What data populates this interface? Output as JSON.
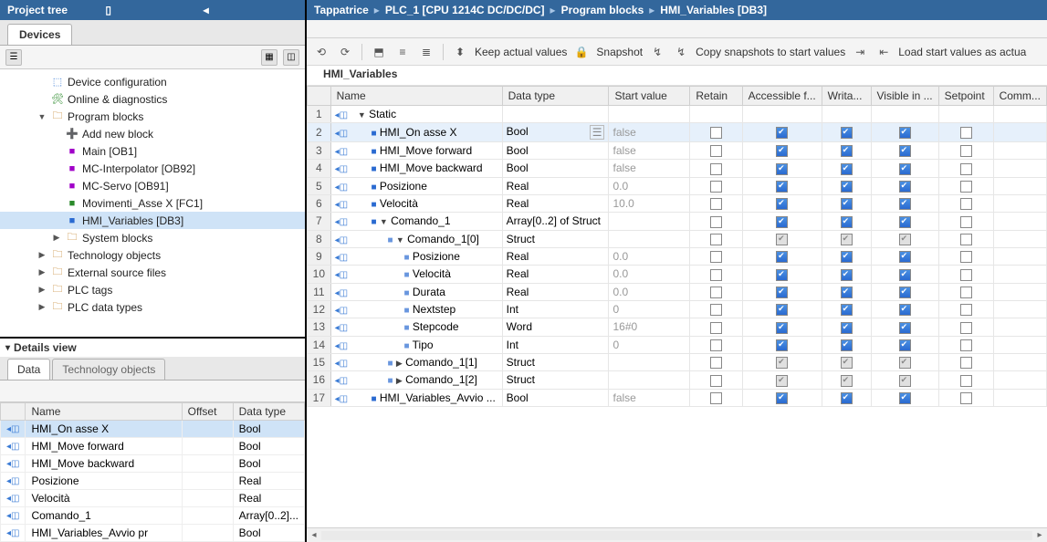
{
  "left": {
    "project_tree_title": "Project tree",
    "devices_tab": "Devices",
    "tree": [
      {
        "indent": 2,
        "icon": "⬚",
        "label": "Device configuration",
        "color": "#3a7bd5"
      },
      {
        "indent": 2,
        "icon": "🛠",
        "label": "Online & diagnostics",
        "color": "#2a8a2a"
      },
      {
        "indent": 2,
        "icon": "🗀",
        "label": "Program blocks",
        "expander": "▼",
        "color": "#b86b00"
      },
      {
        "indent": 3,
        "icon": "➕",
        "label": "Add new block",
        "color": "#a000c8"
      },
      {
        "indent": 3,
        "icon": "■",
        "label": "Main [OB1]",
        "color": "#a000c8"
      },
      {
        "indent": 3,
        "icon": "■",
        "label": "MC-Interpolator [OB92]",
        "color": "#a000c8"
      },
      {
        "indent": 3,
        "icon": "■",
        "label": "MC-Servo [OB91]",
        "color": "#a000c8"
      },
      {
        "indent": 3,
        "icon": "■",
        "label": "Movimenti_Asse X [FC1]",
        "color": "#2a8a2a"
      },
      {
        "indent": 3,
        "icon": "■",
        "label": "HMI_Variables [DB3]",
        "selected": true,
        "color": "#2a6ad1"
      },
      {
        "indent": 3,
        "icon": "🗀",
        "label": "System blocks",
        "expander": "▶",
        "color": "#b86b00"
      },
      {
        "indent": 2,
        "icon": "🗀",
        "label": "Technology objects",
        "expander": "▶",
        "color": "#b86b00"
      },
      {
        "indent": 2,
        "icon": "🗀",
        "label": "External source files",
        "expander": "▶",
        "color": "#b86b00"
      },
      {
        "indent": 2,
        "icon": "🗀",
        "label": "PLC tags",
        "expander": "▶",
        "color": "#b86b00"
      },
      {
        "indent": 2,
        "icon": "🗀",
        "label": "PLC data types",
        "expander": "▶",
        "color": "#b86b00"
      }
    ],
    "details_title": "Details view",
    "details_tabs": {
      "data": "Data",
      "tech": "Technology objects"
    },
    "details_headers": {
      "name": "Name",
      "offset": "Offset",
      "datatype": "Data type"
    },
    "details_rows": [
      {
        "name": "HMI_On asse X",
        "type": "Bool",
        "sel": true
      },
      {
        "name": "HMI_Move forward",
        "type": "Bool"
      },
      {
        "name": "HMI_Move backward",
        "type": "Bool"
      },
      {
        "name": "Posizione",
        "type": "Real"
      },
      {
        "name": "Velocità",
        "type": "Real"
      },
      {
        "name": "Comando_1",
        "type": "Array[0..2]..."
      },
      {
        "name": "HMI_Variables_Avvio pr",
        "type": "Bool",
        "cut": true
      }
    ]
  },
  "right": {
    "crumbs": [
      "Tappatrice",
      "PLC_1 [CPU 1214C DC/DC/DC]",
      "Program blocks",
      "HMI_Variables [DB3]"
    ],
    "toolbar": {
      "keep": "Keep actual values",
      "snapshot": "Snapshot",
      "copy": "Copy snapshots to start values",
      "load": "Load start values as actua"
    },
    "db_title": "HMI_Variables",
    "columns": [
      "",
      "Name",
      "Data type",
      "Start value",
      "Retain",
      "Accessible f...",
      "Writa...",
      "Visible in ...",
      "Setpoint",
      "Comm..."
    ],
    "rows": [
      {
        "n": 1,
        "pin": true,
        "dot": false,
        "exp": "▼",
        "indent": 0,
        "name": "Static",
        "type": "",
        "val": "",
        "checks": [
          "",
          "",
          "",
          "",
          ""
        ]
      },
      {
        "n": 2,
        "pin": true,
        "dot": true,
        "exp": "",
        "indent": 1,
        "name": "HMI_On asse X",
        "type": "Bool",
        "val": "false",
        "sel": true,
        "checks": [
          "off",
          "on",
          "on",
          "on",
          "off"
        ],
        "hasTypeBtn": true
      },
      {
        "n": 3,
        "pin": true,
        "dot": true,
        "exp": "",
        "indent": 1,
        "name": "HMI_Move forward",
        "type": "Bool",
        "val": "false",
        "checks": [
          "off",
          "on",
          "on",
          "on",
          "off"
        ]
      },
      {
        "n": 4,
        "pin": true,
        "dot": true,
        "exp": "",
        "indent": 1,
        "name": "HMI_Move backward",
        "type": "Bool",
        "val": "false",
        "checks": [
          "off",
          "on",
          "on",
          "on",
          "off"
        ]
      },
      {
        "n": 5,
        "pin": true,
        "dot": true,
        "exp": "",
        "indent": 1,
        "name": "Posizione",
        "type": "Real",
        "val": "0.0",
        "checks": [
          "off",
          "on",
          "on",
          "on",
          "off"
        ]
      },
      {
        "n": 6,
        "pin": true,
        "dot": true,
        "exp": "",
        "indent": 1,
        "name": "Velocità",
        "type": "Real",
        "val": "10.0",
        "checks": [
          "off",
          "on",
          "on",
          "on",
          "off"
        ]
      },
      {
        "n": 7,
        "pin": true,
        "dot": true,
        "exp": "▼",
        "indent": 1,
        "name": "Comando_1",
        "type": "Array[0..2] of Struct",
        "val": "",
        "checks": [
          "off",
          "on",
          "on",
          "on",
          "off"
        ]
      },
      {
        "n": 8,
        "pin": true,
        "dot": false,
        "exp": "▼",
        "indent": 2,
        "name": "Comando_1[0]",
        "type": "Struct",
        "val": "",
        "checks": [
          "off",
          "gon",
          "gon",
          "gon",
          "off"
        ],
        "dot2": true
      },
      {
        "n": 9,
        "pin": true,
        "dot": false,
        "exp": "",
        "indent": 3,
        "name": "Posizione",
        "type": "Real",
        "val": "0.0",
        "checks": [
          "off",
          "on",
          "on",
          "on",
          "off"
        ],
        "dot2": true
      },
      {
        "n": 10,
        "pin": true,
        "dot": false,
        "exp": "",
        "indent": 3,
        "name": "Velocità",
        "type": "Real",
        "val": "0.0",
        "checks": [
          "off",
          "on",
          "on",
          "on",
          "off"
        ],
        "dot2": true
      },
      {
        "n": 11,
        "pin": true,
        "dot": false,
        "exp": "",
        "indent": 3,
        "name": "Durata",
        "type": "Real",
        "val": "0.0",
        "checks": [
          "off",
          "on",
          "on",
          "on",
          "off"
        ],
        "dot2": true
      },
      {
        "n": 12,
        "pin": true,
        "dot": false,
        "exp": "",
        "indent": 3,
        "name": "Nextstep",
        "type": "Int",
        "val": "0",
        "checks": [
          "off",
          "on",
          "on",
          "on",
          "off"
        ],
        "dot2": true
      },
      {
        "n": 13,
        "pin": true,
        "dot": false,
        "exp": "",
        "indent": 3,
        "name": "Stepcode",
        "type": "Word",
        "val": "16#0",
        "checks": [
          "off",
          "on",
          "on",
          "on",
          "off"
        ],
        "dot2": true
      },
      {
        "n": 14,
        "pin": true,
        "dot": false,
        "exp": "",
        "indent": 3,
        "name": "Tipo",
        "type": "Int",
        "val": "0",
        "checks": [
          "off",
          "on",
          "on",
          "on",
          "off"
        ],
        "dot2": true
      },
      {
        "n": 15,
        "pin": true,
        "dot": false,
        "exp": "▶",
        "indent": 2,
        "name": "Comando_1[1]",
        "type": "Struct",
        "val": "",
        "checks": [
          "off",
          "gon",
          "gon",
          "gon",
          "off"
        ],
        "dot2": true
      },
      {
        "n": 16,
        "pin": true,
        "dot": false,
        "exp": "▶",
        "indent": 2,
        "name": "Comando_1[2]",
        "type": "Struct",
        "val": "",
        "checks": [
          "off",
          "gon",
          "gon",
          "gon",
          "off"
        ],
        "dot2": true
      },
      {
        "n": 17,
        "pin": true,
        "dot": true,
        "exp": "",
        "indent": 1,
        "name": "HMI_Variables_Avvio ...",
        "type": "Bool",
        "val": "false",
        "checks": [
          "off",
          "on",
          "on",
          "on",
          "off"
        ]
      }
    ]
  }
}
